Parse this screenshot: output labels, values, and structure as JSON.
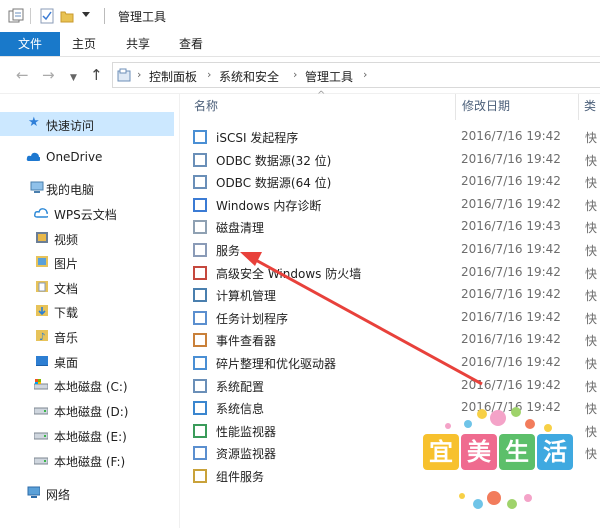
{
  "window": {
    "title": "管理工具"
  },
  "ribbon": {
    "tabs": [
      "文件",
      "主页",
      "共享",
      "查看"
    ]
  },
  "breadcrumb": {
    "items": [
      "控制面板",
      "系统和安全",
      "管理工具"
    ]
  },
  "nav": {
    "quick_access": "快速访问",
    "onedrive": "OneDrive",
    "this_pc": "我的电脑",
    "wps": "WPS云文档",
    "videos": "视频",
    "pictures": "图片",
    "docs": "文档",
    "downloads": "下载",
    "music": "音乐",
    "desktop": "桌面",
    "drive_c": "本地磁盘 (C:)",
    "drive_d": "本地磁盘 (D:)",
    "drive_e": "本地磁盘 (E:)",
    "drive_f": "本地磁盘 (F:)",
    "network": "网络"
  },
  "columns": {
    "name": "名称",
    "date": "修改日期",
    "type": "类"
  },
  "files": [
    {
      "name": "iSCSI 发起程序",
      "date": "2016/7/16 19:42",
      "type": "快"
    },
    {
      "name": "ODBC 数据源(32 位)",
      "date": "2016/7/16 19:42",
      "type": "快"
    },
    {
      "name": "ODBC 数据源(64 位)",
      "date": "2016/7/16 19:42",
      "type": "快"
    },
    {
      "name": "Windows 内存诊断",
      "date": "2016/7/16 19:42",
      "type": "快"
    },
    {
      "name": "磁盘清理",
      "date": "2016/7/16 19:43",
      "type": "快"
    },
    {
      "name": "服务",
      "date": "2016/7/16 19:42",
      "type": "快"
    },
    {
      "name": "高级安全 Windows 防火墙",
      "date": "2016/7/16 19:42",
      "type": "快"
    },
    {
      "name": "计算机管理",
      "date": "2016/7/16 19:42",
      "type": "快"
    },
    {
      "name": "任务计划程序",
      "date": "2016/7/16 19:42",
      "type": "快"
    },
    {
      "name": "事件查看器",
      "date": "2016/7/16 19:42",
      "type": "快"
    },
    {
      "name": "碎片整理和优化驱动器",
      "date": "2016/7/16 19:42",
      "type": "快"
    },
    {
      "name": "系统配置",
      "date": "2016/7/16 19:42",
      "type": "快"
    },
    {
      "name": "系统信息",
      "date": "2016/7/16 19:42",
      "type": "快"
    },
    {
      "name": "性能监视器",
      "date": "",
      "type": "快"
    },
    {
      "name": "资源监视器",
      "date": "",
      "type": "快"
    },
    {
      "name": "组件服务",
      "date": "",
      "type": ""
    }
  ],
  "watermark": {
    "chars": [
      "宜",
      "美",
      "生",
      "活"
    ]
  },
  "colors": {
    "accent": "#1979ca",
    "selection": "#cce8ff",
    "arrow": "#e8413b"
  }
}
